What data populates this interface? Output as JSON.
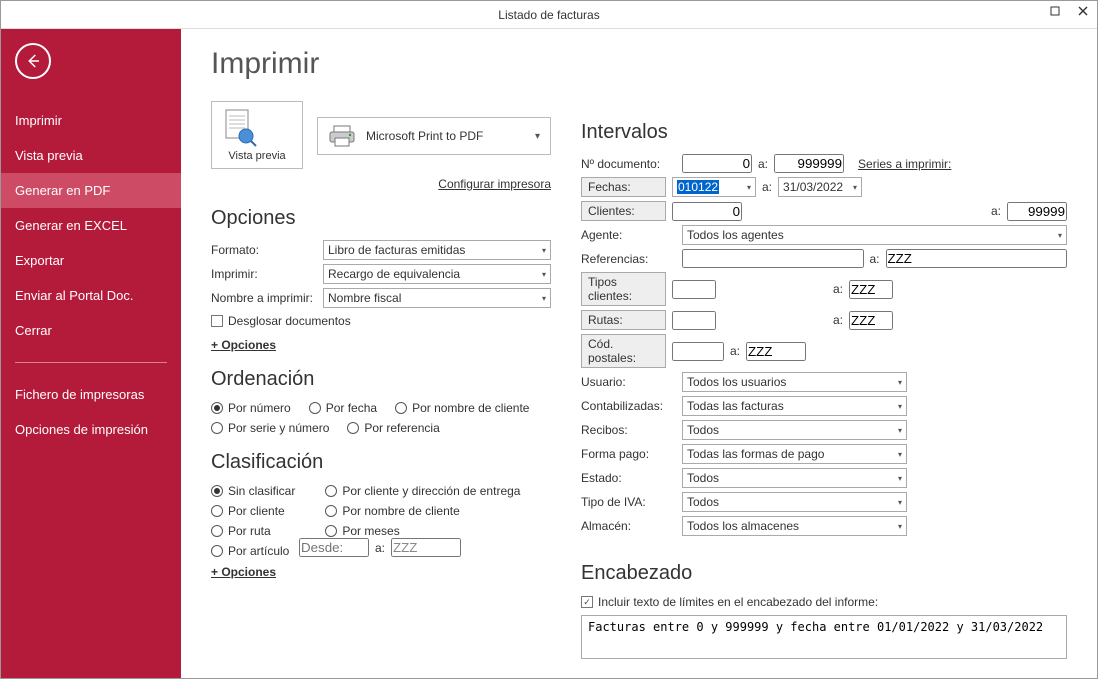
{
  "window": {
    "title": "Listado de facturas"
  },
  "sidebar": {
    "items": [
      {
        "label": "Imprimir"
      },
      {
        "label": "Vista previa"
      },
      {
        "label": "Generar en PDF"
      },
      {
        "label": "Generar en EXCEL"
      },
      {
        "label": "Exportar"
      },
      {
        "label": "Enviar al Portal Doc."
      },
      {
        "label": "Cerrar"
      }
    ],
    "group2": [
      {
        "label": "Fichero de impresoras"
      },
      {
        "label": "Opciones de impresión"
      }
    ]
  },
  "page": {
    "title": "Imprimir"
  },
  "preview": {
    "label": "Vista previa"
  },
  "printer": {
    "name": "Microsoft Print to PDF",
    "config_link": "Configurar impresora"
  },
  "options": {
    "heading": "Opciones",
    "format_lbl": "Formato:",
    "format_val": "Libro de facturas emitidas",
    "print_lbl": "Imprimir:",
    "print_val": "Recargo de equivalencia",
    "name_lbl": "Nombre a imprimir:",
    "name_val": "Nombre fiscal",
    "breakdown_chk": "Desglosar documentos",
    "more": "+ Opciones"
  },
  "sort": {
    "heading": "Ordenación",
    "by_number": "Por número",
    "by_date": "Por fecha",
    "by_client_name": "Por nombre de cliente",
    "by_series_number": "Por serie y número",
    "by_reference": "Por referencia"
  },
  "class": {
    "heading": "Clasificación",
    "none": "Sin clasificar",
    "by_client_addr": "Por cliente y dirección de entrega",
    "by_client": "Por cliente",
    "by_client_name": "Por nombre de cliente",
    "by_route": "Por ruta",
    "by_months": "Por meses",
    "by_article": "Por artículo",
    "from_lbl": "Desde:",
    "to_lbl": "a:",
    "to_val": "ZZZ",
    "more": "+ Opciones"
  },
  "intervals": {
    "heading": "Intervalos",
    "doc_lbl": "Nº documento:",
    "doc_from": "0",
    "a": "a:",
    "doc_to": "999999",
    "series_link": "Series a imprimir:",
    "dates_btn": "Fechas:",
    "date_from": "010122",
    "date_to": "31/03/2022",
    "clients_btn": "Clientes:",
    "client_from": "0",
    "client_to": "99999",
    "agent_lbl": "Agente:",
    "agent_val": "Todos los agentes",
    "ref_lbl": "Referencias:",
    "ref_to": "ZZZ",
    "clienttype_btn": "Tipos clientes:",
    "clienttype_to": "ZZZ",
    "routes_btn": "Rutas:",
    "routes_to": "ZZZ",
    "postal_btn": "Cód. postales:",
    "postal_to": "ZZZ",
    "user_lbl": "Usuario:",
    "user_val": "Todos los usuarios",
    "posted_lbl": "Contabilizadas:",
    "posted_val": "Todas las facturas",
    "receipts_lbl": "Recibos:",
    "receipts_val": "Todos",
    "paytype_lbl": "Forma pago:",
    "paytype_val": "Todas las formas de pago",
    "state_lbl": "Estado:",
    "state_val": "Todos",
    "vat_lbl": "Tipo de IVA:",
    "vat_val": "Todos",
    "wh_lbl": "Almacén:",
    "wh_val": "Todos los almacenes"
  },
  "header": {
    "heading": "Encabezado",
    "chk": "Incluir texto de límites en el encabezado del informe:",
    "text": "Facturas entre 0 y 999999 y fecha entre 01/01/2022 y 31/03/2022"
  }
}
